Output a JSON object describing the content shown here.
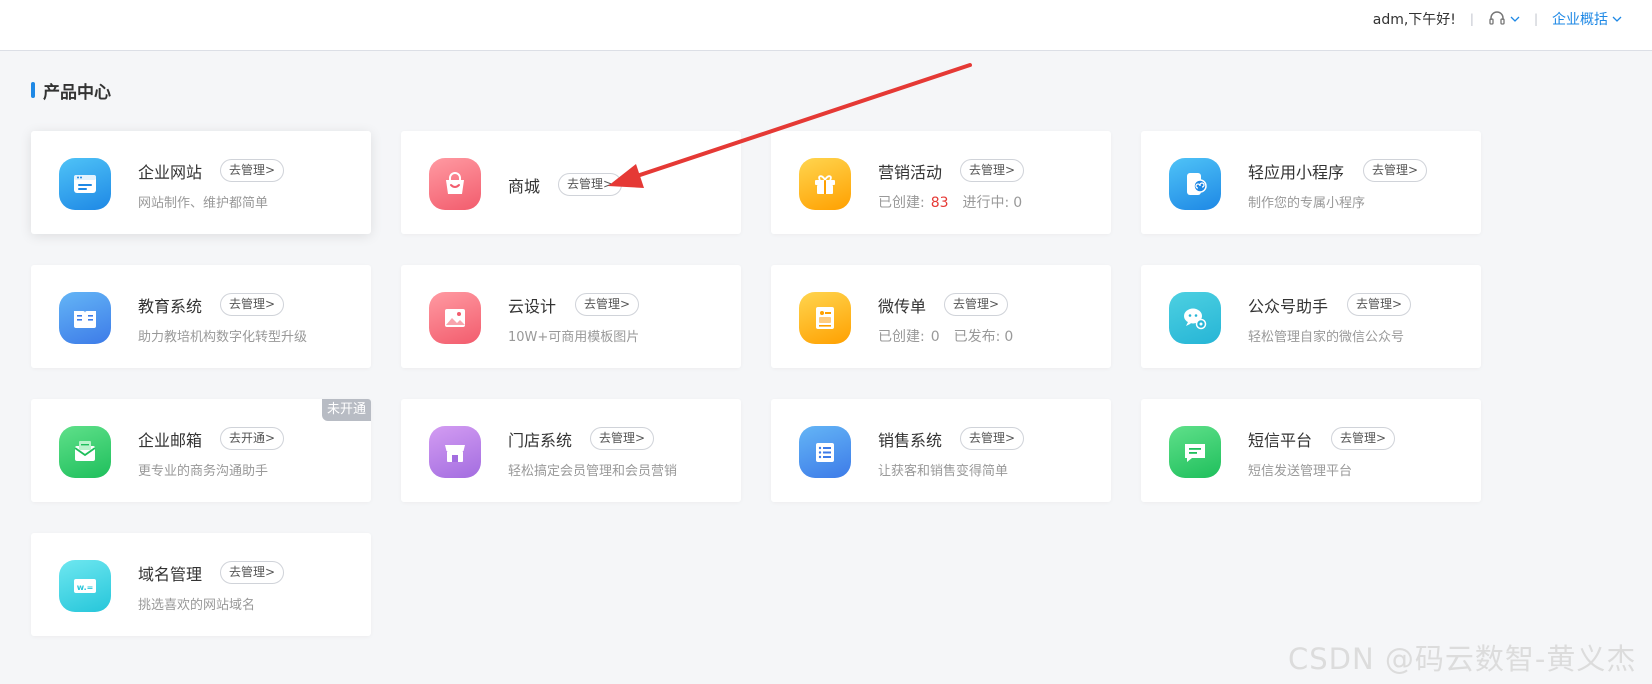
{
  "header": {
    "greeting": "adm,下午好!",
    "separator": "|",
    "support_icon": "headset-icon",
    "overview_label": "企业概括"
  },
  "section": {
    "title": "产品中心"
  },
  "cards": [
    {
      "name": "企业网站",
      "manage": "去管理>",
      "desc": "网站制作、维护都简单",
      "icon": "website-icon",
      "color_top": "#4fc3f7",
      "color_bottom": "#1e88e5"
    },
    {
      "name": "商城",
      "manage": "去管理>",
      "desc": "",
      "icon": "shopping-bag-icon",
      "color_top": "#ff9aa2",
      "color_bottom": "#f25c6d"
    },
    {
      "name": "营销活动",
      "manage": "去管理>",
      "stats": {
        "created_label": "已创建:",
        "created_value": "83",
        "active_label": "进行中:",
        "active_value": "0"
      },
      "icon": "gift-icon",
      "color_top": "#ffd54f",
      "color_bottom": "#ffa000"
    },
    {
      "name": "轻应用小程序",
      "manage": "去管理>",
      "desc": "制作您的专属小程序",
      "icon": "mini-program-icon",
      "color_top": "#4fc3f7",
      "color_bottom": "#1e88e5"
    },
    {
      "name": "教育系统",
      "manage": "去管理>",
      "desc": "助力教培机构数字化转型升级",
      "icon": "book-icon",
      "color_top": "#64b5f6",
      "color_bottom": "#3d7be8"
    },
    {
      "name": "云设计",
      "manage": "去管理>",
      "desc": "10W+可商用模板图片",
      "icon": "image-icon",
      "color_top": "#ff9aa2",
      "color_bottom": "#f25c6d"
    },
    {
      "name": "微传单",
      "manage": "去管理>",
      "stats": {
        "created_label": "已创建:",
        "created_value": "0",
        "active_label": "已发布:",
        "active_value": "0"
      },
      "icon": "flyer-icon",
      "color_top": "#ffd54f",
      "color_bottom": "#ffa000"
    },
    {
      "name": "公众号助手",
      "manage": "去管理>",
      "desc": "轻松管理自家的微信公众号",
      "icon": "wechat-icon",
      "color_top": "#4dd0e1",
      "color_bottom": "#26b5d6"
    },
    {
      "name": "企业邮箱",
      "manage": "去开通>",
      "desc": "更专业的商务沟通助手",
      "icon": "mail-icon",
      "color_top": "#5fe08a",
      "color_bottom": "#1fbf5c",
      "badge": "未开通"
    },
    {
      "name": "门店系统",
      "manage": "去管理>",
      "desc": "轻松搞定会员管理和会员营销",
      "icon": "store-icon",
      "color_top": "#d39cf2",
      "color_bottom": "#a36de0"
    },
    {
      "name": "销售系统",
      "manage": "去管理>",
      "desc": "让获客和销售变得简单",
      "icon": "list-icon",
      "color_top": "#64b5f6",
      "color_bottom": "#3d7be8"
    },
    {
      "name": "短信平台",
      "manage": "去管理>",
      "desc": "短信发送管理平台",
      "icon": "sms-icon",
      "color_top": "#5fe08a",
      "color_bottom": "#1fbf5c"
    },
    {
      "name": "域名管理",
      "manage": "去管理>",
      "desc": "挑选喜欢的网站域名",
      "icon": "domain-icon",
      "color_top": "#6ee7f0",
      "color_bottom": "#26c6da"
    }
  ],
  "annotation": {
    "arrow_color": "#e53935"
  },
  "watermark": "CSDN @码云数智-黄义杰"
}
